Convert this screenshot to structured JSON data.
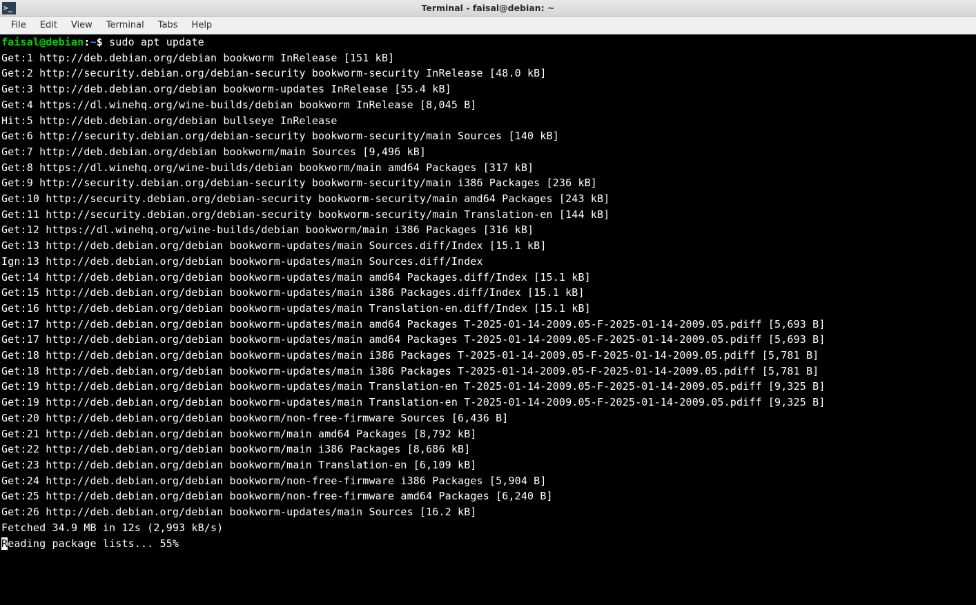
{
  "window": {
    "title": "Terminal - faisal@debian: ~",
    "icon_glyph": ">_"
  },
  "menubar": {
    "items": [
      "File",
      "Edit",
      "View",
      "Terminal",
      "Tabs",
      "Help"
    ]
  },
  "prompt": {
    "user_host": "faisal@debian",
    "separator": ":",
    "path": "~",
    "symbol": "$",
    "command": "sudo apt update"
  },
  "output_lines": [
    "Get:1 http://deb.debian.org/debian bookworm InRelease [151 kB]",
    "Get:2 http://security.debian.org/debian-security bookworm-security InRelease [48.0 kB]",
    "Get:3 http://deb.debian.org/debian bookworm-updates InRelease [55.4 kB]",
    "Get:4 https://dl.winehq.org/wine-builds/debian bookworm InRelease [8,045 B]",
    "Hit:5 http://deb.debian.org/debian bullseye InRelease",
    "Get:6 http://security.debian.org/debian-security bookworm-security/main Sources [140 kB]",
    "Get:7 http://deb.debian.org/debian bookworm/main Sources [9,496 kB]",
    "Get:8 https://dl.winehq.org/wine-builds/debian bookworm/main amd64 Packages [317 kB]",
    "Get:9 http://security.debian.org/debian-security bookworm-security/main i386 Packages [236 kB]",
    "Get:10 http://security.debian.org/debian-security bookworm-security/main amd64 Packages [243 kB]",
    "Get:11 http://security.debian.org/debian-security bookworm-security/main Translation-en [144 kB]",
    "Get:12 https://dl.winehq.org/wine-builds/debian bookworm/main i386 Packages [316 kB]",
    "Get:13 http://deb.debian.org/debian bookworm-updates/main Sources.diff/Index [15.1 kB]",
    "Ign:13 http://deb.debian.org/debian bookworm-updates/main Sources.diff/Index",
    "Get:14 http://deb.debian.org/debian bookworm-updates/main amd64 Packages.diff/Index [15.1 kB]",
    "Get:15 http://deb.debian.org/debian bookworm-updates/main i386 Packages.diff/Index [15.1 kB]",
    "Get:16 http://deb.debian.org/debian bookworm-updates/main Translation-en.diff/Index [15.1 kB]",
    "Get:17 http://deb.debian.org/debian bookworm-updates/main amd64 Packages T-2025-01-14-2009.05-F-2025-01-14-2009.05.pdiff [5,693 B]",
    "Get:17 http://deb.debian.org/debian bookworm-updates/main amd64 Packages T-2025-01-14-2009.05-F-2025-01-14-2009.05.pdiff [5,693 B]",
    "Get:18 http://deb.debian.org/debian bookworm-updates/main i386 Packages T-2025-01-14-2009.05-F-2025-01-14-2009.05.pdiff [5,781 B]",
    "Get:18 http://deb.debian.org/debian bookworm-updates/main i386 Packages T-2025-01-14-2009.05-F-2025-01-14-2009.05.pdiff [5,781 B]",
    "Get:19 http://deb.debian.org/debian bookworm-updates/main Translation-en T-2025-01-14-2009.05-F-2025-01-14-2009.05.pdiff [9,325 B]",
    "Get:19 http://deb.debian.org/debian bookworm-updates/main Translation-en T-2025-01-14-2009.05-F-2025-01-14-2009.05.pdiff [9,325 B]",
    "Get:20 http://deb.debian.org/debian bookworm/non-free-firmware Sources [6,436 B]",
    "Get:21 http://deb.debian.org/debian bookworm/main amd64 Packages [8,792 kB]",
    "Get:22 http://deb.debian.org/debian bookworm/main i386 Packages [8,686 kB]",
    "Get:23 http://deb.debian.org/debian bookworm/main Translation-en [6,109 kB]",
    "Get:24 http://deb.debian.org/debian bookworm/non-free-firmware i386 Packages [5,904 B]",
    "Get:25 http://deb.debian.org/debian bookworm/non-free-firmware amd64 Packages [6,240 B]",
    "Get:26 http://deb.debian.org/debian bookworm-updates/main Sources [16.2 kB]",
    "Fetched 34.9 MB in 12s (2,993 kB/s)"
  ],
  "status_line": {
    "first_char": "R",
    "rest": "eading package lists... 55%"
  }
}
